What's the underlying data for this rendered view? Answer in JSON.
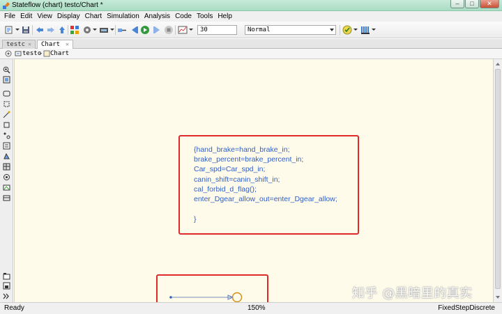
{
  "window": {
    "title": "Stateflow (chart) testc/Chart *",
    "minimize_glyph": "–",
    "maximize_glyph": "□",
    "close_glyph": "✕"
  },
  "menu": {
    "items": [
      "File",
      "Edit",
      "View",
      "Display",
      "Chart",
      "Simulation",
      "Analysis",
      "Code",
      "Tools",
      "Help"
    ]
  },
  "toolbar": {
    "stop_time": "30",
    "sim_mode": "Normal",
    "icons": [
      "new-icon",
      "save-icon",
      "back-icon",
      "forward-icon",
      "up-icon",
      "library-icon",
      "model-settings-icon",
      "hardware-icon",
      "step-back-icon",
      "run-icon",
      "step-forward-icon",
      "stop-icon",
      "scope-icon",
      "check-icon",
      "build-icon"
    ]
  },
  "tabs": [
    {
      "label": "testc"
    },
    {
      "label": "Chart"
    }
  ],
  "breadcrumb": {
    "model": "testc",
    "chart": "Chart"
  },
  "chart": {
    "action_lines": [
      "{hand_brake=hand_brake_in;",
      "brake_percent=brake_percent_in;",
      "Car_spd=Car_spd_in;",
      "canin_shift=canin_shift_in;",
      "cal_forbid_d_flag();",
      "enter_Dgear_allow_out=enter_Dgear_allow;",
      "",
      "}"
    ],
    "annotation_color": "#e02a2a",
    "action_text_color": "#2f5fc9",
    "canvas_color": "#fffbea"
  },
  "status": {
    "state": "Ready",
    "zoom": "150%",
    "solver": "FixedStepDiscrete"
  },
  "watermark": {
    "text": "知乎 @黑暗里的真实"
  }
}
